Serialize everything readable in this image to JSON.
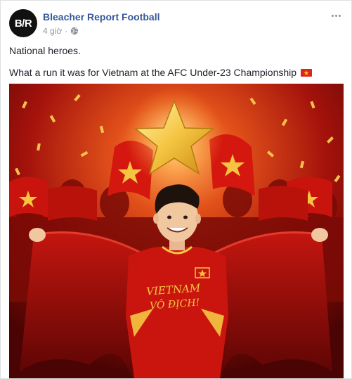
{
  "post": {
    "avatar_text": "B/R",
    "page_name": "Bleacher Report Football",
    "time": "4 giờ",
    "separator": "·",
    "lines": [
      "National heroes.",
      "What a run it was for Vietnam at the AFC Under-23 Championship"
    ]
  },
  "image": {
    "shirt_text_line1": "VIETNAM",
    "shirt_text_line2": "VÔ ĐỊCH!"
  },
  "colors": {
    "link": "#365899",
    "flag_red": "#da251d",
    "flag_star": "#ffcd00"
  },
  "icons": {
    "privacy": "globe-icon",
    "menu": "more-options-icon",
    "flag": "vietnam-flag-icon"
  }
}
